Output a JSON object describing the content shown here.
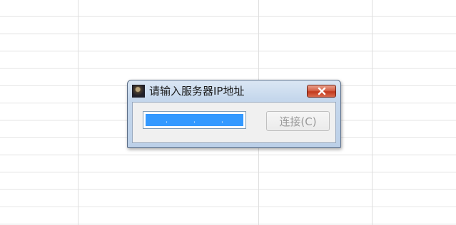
{
  "dialog": {
    "title": "请输入服务器IP地址",
    "app_icon": "game-app-icon",
    "close_icon": "close-icon",
    "ip_field": {
      "separators": [
        ".",
        ".",
        "."
      ],
      "state": "selected"
    },
    "connect_label": "连接(C)",
    "connect_enabled": false
  },
  "colors": {
    "titlebar": "#c5d7ec",
    "close_button": "#c2391e",
    "selection": "#3399ff",
    "disabled_text": "#9a9a9a"
  }
}
